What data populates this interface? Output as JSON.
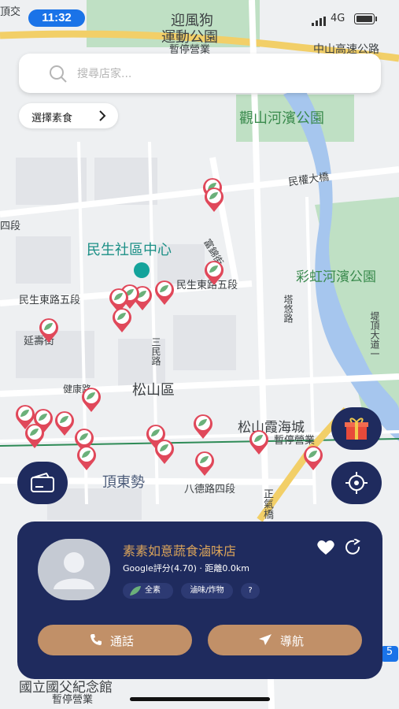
{
  "status_bar": {
    "time": "11:32",
    "network": "4G"
  },
  "search": {
    "placeholder": "搜尋店家..."
  },
  "filter_chip": {
    "label": "選擇素食"
  },
  "map_labels": {
    "park_1": "迎風狗",
    "park_2": "運動公園",
    "park_3": "暫停營業",
    "highway": "中山高速公路",
    "guanshan": "觀山河濱公園",
    "minquan_bridge": "民權大橋",
    "section4": "四段",
    "minsheng_center": "民生社區中心",
    "fujin": "富錦街",
    "rainbow": "彩虹河濱公園",
    "minsheng_e5_a": "民生東路五段",
    "minsheng_e5_b": "民生東路五段",
    "tanyou": "塔悠路",
    "yanshou": "延壽街",
    "sanmin": "三民路",
    "dike": "堤頂大道一",
    "jiankang": "健康路",
    "songshan": "松山區",
    "xiahai": "松山霞海城",
    "xiahai_status": "暫停營業",
    "dingdongshi": "頂東勢",
    "bade": "八德路四段",
    "zhengqi": "正氣橋",
    "top_left": "頂交",
    "memorial": "國立國父紀念館",
    "memorial_status": "暫停營業",
    "route": "5"
  },
  "shop_card": {
    "name": "素素如意蔬食滷味店",
    "rating_line": "Google評分(4.70) · 距離0.0km",
    "tags": [
      "全素",
      "滷味/炸物",
      "?"
    ],
    "call_label": "通話",
    "navigate_label": "導航"
  },
  "colors": {
    "navy": "#1f2b5e",
    "accent_gold": "#d9a35a",
    "button_brown": "#c19068",
    "pin_red": "#e0485a",
    "pin_leaf": "#6bb07a",
    "river": "#a6c6ee",
    "park": "#bfe0c4"
  },
  "icons": {
    "search": "search-icon",
    "chevron": "chevron-right-icon",
    "gift": "gift-icon",
    "wallet": "wallet-icon",
    "locate": "crosshair-icon",
    "heart": "heart-icon",
    "share": "share-icon",
    "phone": "phone-icon",
    "send": "navigate-icon",
    "pin": "store-pin-icon"
  }
}
